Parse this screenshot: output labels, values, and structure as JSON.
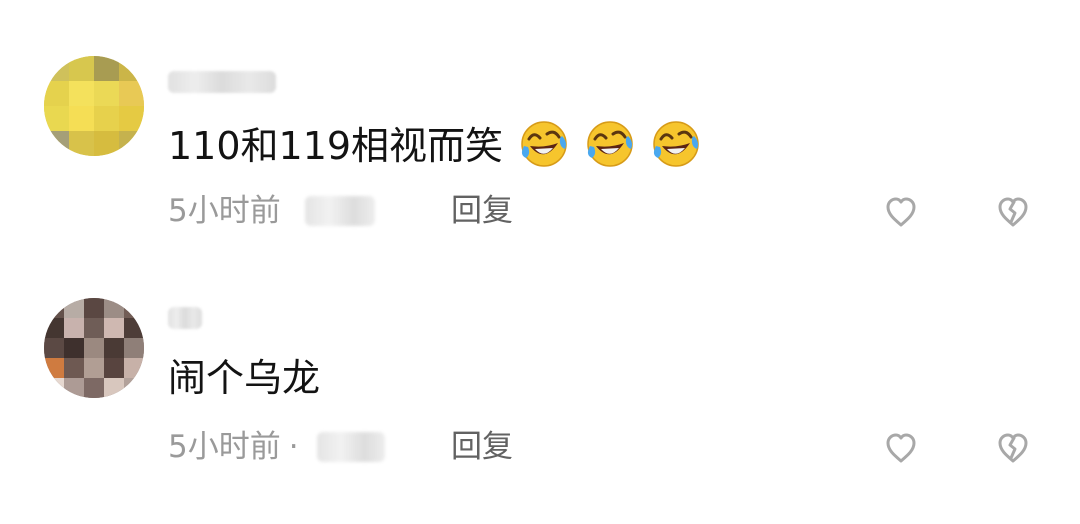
{
  "comments": [
    {
      "text": "110和119相视而笑",
      "emoji_count": 3,
      "emoji_icon": "rolling-on-floor-laughing-icon",
      "time": "5小时前",
      "reply_label": "回复",
      "avatar_colors": [
        "#e0d14a",
        "#f1df56",
        "#c6ad22"
      ]
    },
    {
      "text": "闹个乌龙",
      "emoji_count": 0,
      "time": "5小时前",
      "separator": "·",
      "reply_label": "回复",
      "avatar_colors": [
        "#8f756f",
        "#5b4742",
        "#c8b9b1"
      ]
    }
  ],
  "icons": {
    "like": "heart-outline-icon",
    "dislike": "broken-heart-icon"
  },
  "colors": {
    "meta_text": "#9a9a9a",
    "reply_text": "#626262",
    "icon_stroke": "#a8a8a8"
  }
}
